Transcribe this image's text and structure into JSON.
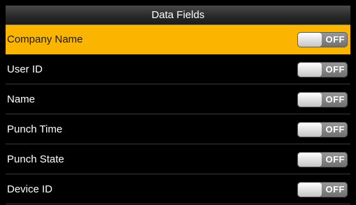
{
  "header": {
    "title": "Data Fields"
  },
  "fields": [
    {
      "label": "Company Name",
      "state": "OFF",
      "selected": true
    },
    {
      "label": "User ID",
      "state": "OFF",
      "selected": false
    },
    {
      "label": "Name",
      "state": "OFF",
      "selected": false
    },
    {
      "label": "Punch Time",
      "state": "OFF",
      "selected": false
    },
    {
      "label": "Punch State",
      "state": "OFF",
      "selected": false
    },
    {
      "label": "Device ID",
      "state": "OFF",
      "selected": false
    }
  ],
  "colors": {
    "selected_background": "#fbb400",
    "background": "#000000",
    "text": "#ffffff"
  }
}
